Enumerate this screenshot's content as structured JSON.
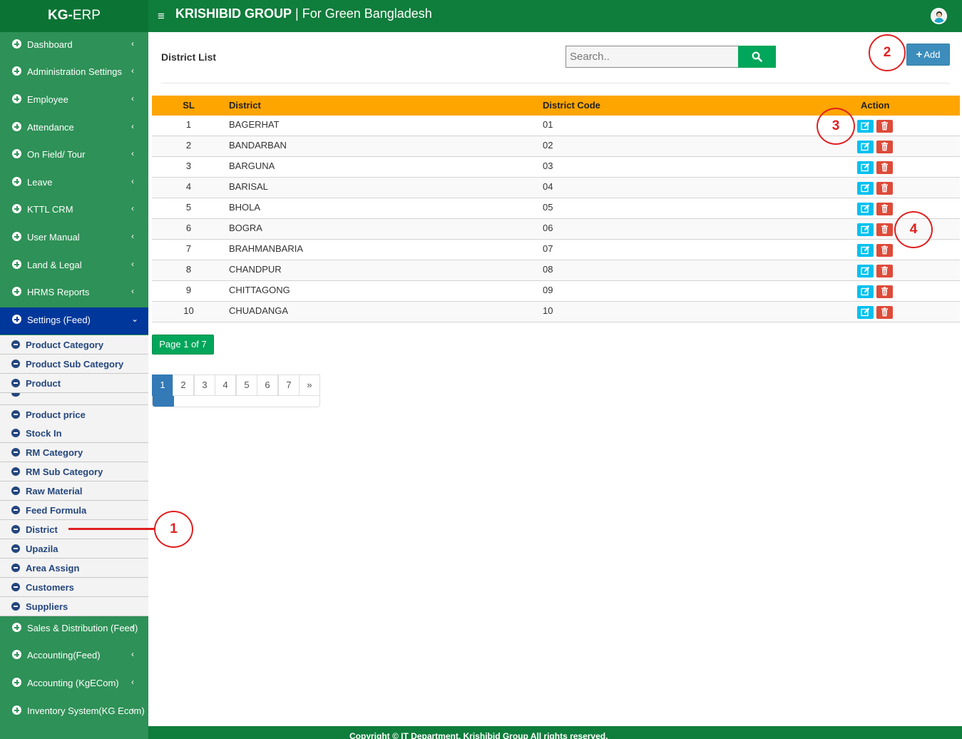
{
  "brand": {
    "bold": "KG-",
    "rest": "ERP"
  },
  "header": {
    "company": "KRISHIBID GROUP",
    "separator": " | ",
    "tagline": "For Green Bangladesh"
  },
  "icons": {
    "menu": "hamburger-icon",
    "search": "search-icon",
    "add": "plus-icon",
    "edit": "edit-icon",
    "delete": "trash-icon",
    "profile": "user-avatar-icon"
  },
  "colors": {
    "header": "#0f7d3b",
    "sidebar": "#2e9157",
    "active_menu": "#00379a",
    "table_header": "#ffa500",
    "edit": "#00c0ef",
    "delete": "#dd4b39",
    "annotation": "#e02020"
  },
  "sidebar": {
    "menu": [
      {
        "label": "Dashboard",
        "chevron": "‹"
      },
      {
        "label": "Administration Settings",
        "chevron": "‹"
      },
      {
        "label": "Employee",
        "chevron": "‹"
      },
      {
        "label": "Attendance",
        "chevron": "‹"
      },
      {
        "label": "On Field/ Tour",
        "chevron": "‹"
      },
      {
        "label": "Leave",
        "chevron": "‹"
      },
      {
        "label": "KTTL CRM",
        "chevron": "‹"
      },
      {
        "label": "User Manual",
        "chevron": "‹"
      },
      {
        "label": "Land & Legal",
        "chevron": "‹"
      },
      {
        "label": "HRMS Reports",
        "chevron": "‹"
      },
      {
        "label": "Settings (Feed)",
        "chevron": "⌄"
      }
    ],
    "submenu": [
      "Product Category",
      "Product Sub Category",
      "Product",
      "",
      "Product price",
      "Stock In",
      "RM Category",
      "RM Sub Category",
      "Raw Material",
      "Feed Formula",
      "District",
      "Upazila",
      "Area Assign",
      "Customers",
      "Suppliers"
    ],
    "bottom_menu": [
      {
        "label": "Sales & Distribution (Feed)",
        "chevron": "‹"
      },
      {
        "label": "Accounting(Feed)",
        "chevron": "‹"
      },
      {
        "label": "Accounting (KgECom)",
        "chevron": "‹"
      },
      {
        "label": "Inventory System(KG Ecom)",
        "chevron": "‹"
      }
    ]
  },
  "main": {
    "title": "District List",
    "search_placeholder": "Search..",
    "add_label": "Add",
    "add_icon_glyph": "+",
    "columns": {
      "sl": "SL",
      "district": "District",
      "code": "District Code",
      "action": "Action"
    },
    "rows": [
      {
        "sl": "1",
        "district": "BAGERHAT",
        "code": "01"
      },
      {
        "sl": "2",
        "district": "BANDARBAN",
        "code": "02"
      },
      {
        "sl": "3",
        "district": "BARGUNA",
        "code": "03"
      },
      {
        "sl": "4",
        "district": "BARISAL",
        "code": "04"
      },
      {
        "sl": "5",
        "district": "BHOLA",
        "code": "05"
      },
      {
        "sl": "6",
        "district": "BOGRA",
        "code": "06"
      },
      {
        "sl": "7",
        "district": "BRAHMANBARIA",
        "code": "07"
      },
      {
        "sl": "8",
        "district": "CHANDPUR",
        "code": "08"
      },
      {
        "sl": "9",
        "district": "CHITTAGONG",
        "code": "09"
      },
      {
        "sl": "10",
        "district": "CHUADANGA",
        "code": "10"
      }
    ],
    "page_badge": "Page 1 of 7",
    "pages": [
      "1",
      "2",
      "3",
      "4",
      "5",
      "6",
      "7",
      "»"
    ]
  },
  "footer": {
    "text": "Copyright © IT Department, Krishibid Group All rights reserved."
  },
  "annotations": {
    "a1": "1",
    "a2": "2",
    "a3": "3",
    "a4": "4"
  }
}
